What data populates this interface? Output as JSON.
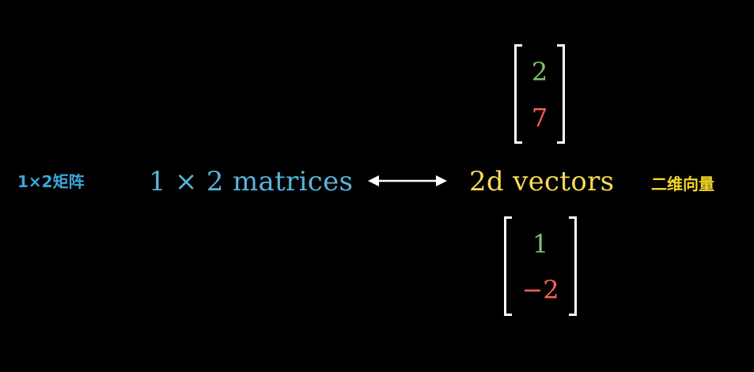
{
  "labels": {
    "zh_left": "1×2矩阵",
    "term_left": "1 × 2 matrices",
    "term_right": "2d vectors",
    "zh_right": "二维向量"
  },
  "vectors": {
    "top": [
      "2",
      "7"
    ],
    "bottom": [
      "1",
      "−2"
    ]
  },
  "colors": {
    "background": "#000000",
    "blue": "#58b4dd",
    "yellow": "#f7dc55",
    "green": "#83c167",
    "red": "#fc6255",
    "white": "#ffffff"
  },
  "icons": {
    "arrow": "double-headed-arrow-icon"
  }
}
